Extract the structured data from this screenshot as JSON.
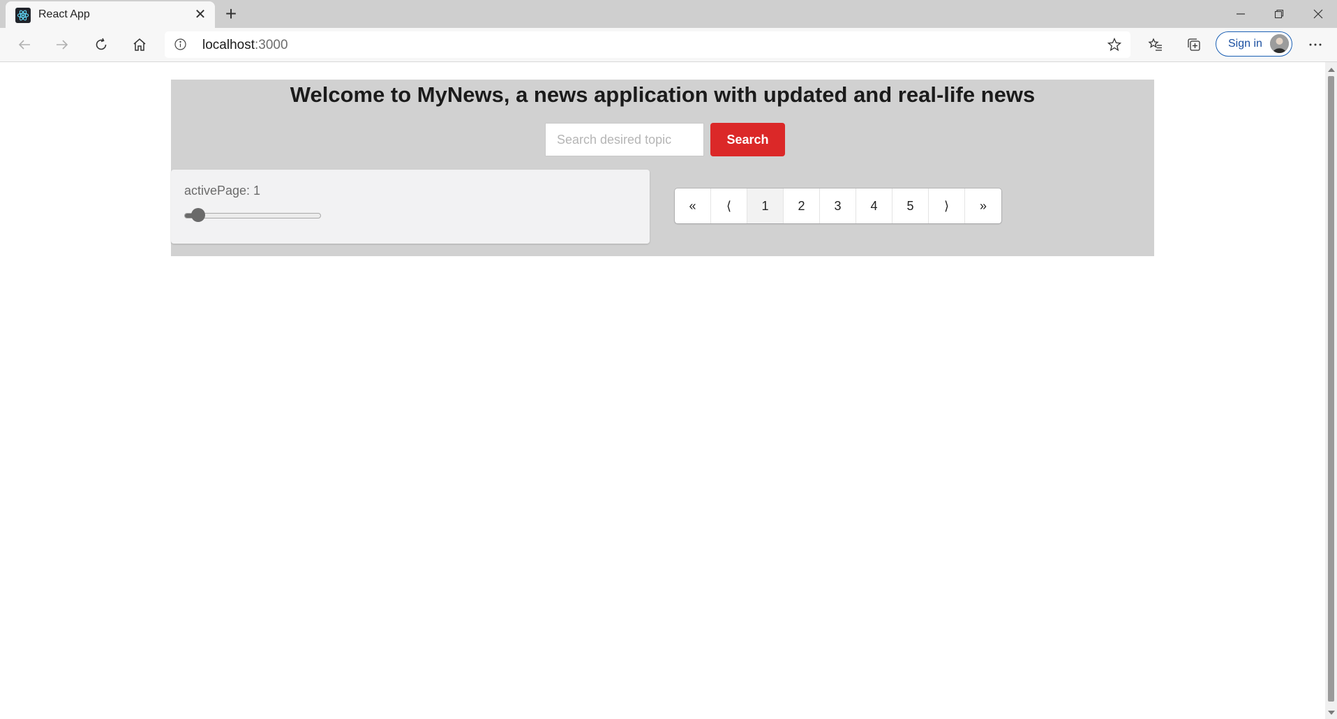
{
  "browser": {
    "tab_title": "React App",
    "new_tab_symbol": "+",
    "close_tab_symbol": "✕",
    "url_host": "localhost",
    "url_port": ":3000",
    "signin_label": "Sign in"
  },
  "page": {
    "headline": "Welcome to MyNews, a news application with updated and real-life news",
    "search": {
      "placeholder": "Search desired topic",
      "value": "",
      "button_label": "Search"
    },
    "active_page_label": "activePage: 1",
    "slider": {
      "value": 1,
      "min": 1,
      "max": 10
    },
    "pagination": {
      "first": "«",
      "prev": "⟨",
      "pages": [
        "1",
        "2",
        "3",
        "4",
        "5"
      ],
      "active": "1",
      "next": "⟩",
      "last": "»"
    }
  },
  "colors": {
    "accent_red": "#db2828",
    "signin_blue": "#1a5fb4",
    "app_background": "#d1d1d1"
  },
  "icons": [
    "react-favicon-icon",
    "close-icon",
    "plus-icon",
    "minimize-icon",
    "restore-icon",
    "window-close-icon",
    "back-icon",
    "forward-icon",
    "refresh-icon",
    "home-icon",
    "info-icon",
    "star-icon",
    "favorites-icon",
    "collections-icon",
    "more-icon"
  ]
}
